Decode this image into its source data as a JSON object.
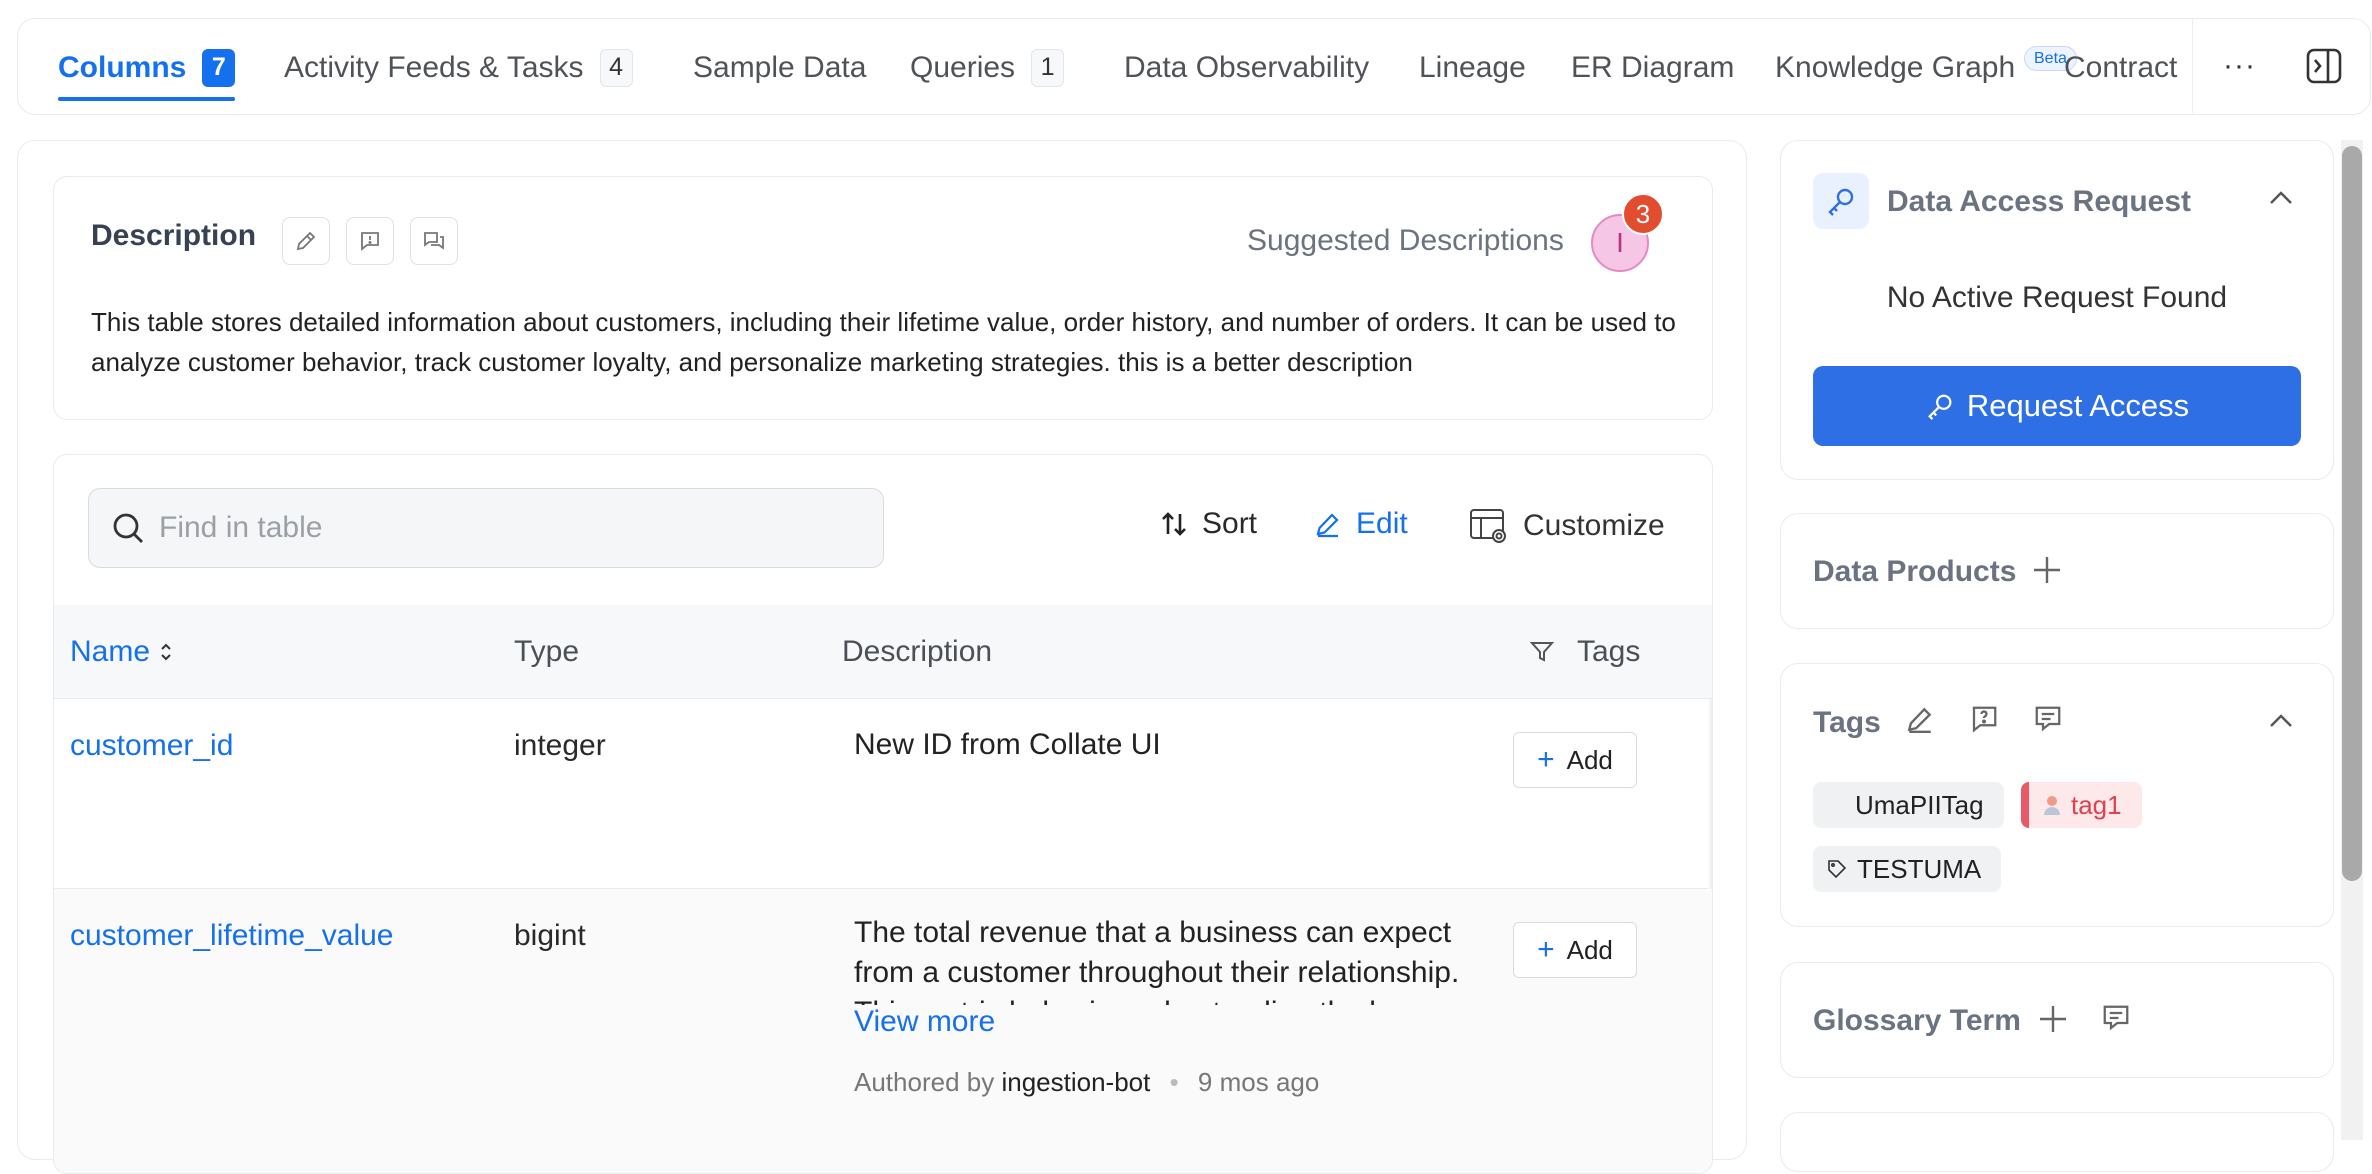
{
  "tabs": [
    {
      "label": "Columns",
      "count": "7",
      "active": true
    },
    {
      "label": "Activity Feeds & Tasks",
      "count": "4"
    },
    {
      "label": "Sample Data"
    },
    {
      "label": "Queries",
      "count": "1"
    },
    {
      "label": "Data Observability"
    },
    {
      "label": "Lineage"
    },
    {
      "label": "ER Diagram"
    },
    {
      "label": "Knowledge Graph",
      "badge": "Beta"
    },
    {
      "label": "Contract"
    }
  ],
  "tab_tools": {
    "more": "···"
  },
  "description": {
    "title": "Description",
    "suggested_label": "Suggested Descriptions",
    "suggested_avatar": "I",
    "suggested_count": "3",
    "text": "This table stores detailed information about customers, including their lifetime value, order history, and number of orders. It can be used to analyze customer behavior, track customer loyalty, and personalize marketing strategies. this is a better description"
  },
  "table_toolbar": {
    "search_placeholder": "Find in table",
    "sort": "Sort",
    "edit": "Edit",
    "customize": "Customize"
  },
  "table": {
    "headers": {
      "name": "Name",
      "type": "Type",
      "description": "Description",
      "tags": "Tags"
    },
    "rows": [
      {
        "name": "customer_id",
        "type": "integer",
        "description": "New ID from Collate UI",
        "add": "Add"
      },
      {
        "name": "customer_lifetime_value",
        "type": "bigint",
        "description": "The total revenue that a business can expect from a customer throughout their relationship. This metric helps in understanding the long-",
        "view_more": "View more",
        "authored_prefix": "Authored by",
        "author": "ingestion-bot",
        "age": "9 mos ago",
        "add": "Add"
      }
    ]
  },
  "right_panel": {
    "data_access": {
      "title": "Data Access Request",
      "empty": "No Active Request Found",
      "button": "Request Access"
    },
    "data_products": {
      "title": "Data Products"
    },
    "tags": {
      "title": "Tags",
      "items": [
        "UmaPIITag",
        "tag1",
        "TESTUMA"
      ]
    },
    "glossary": {
      "title": "Glossary Term"
    }
  },
  "colors": {
    "accent": "#1570ef",
    "primary_button": "#2f6fe5",
    "badge": "#e24c2f",
    "tag_red": "#e0404f"
  }
}
